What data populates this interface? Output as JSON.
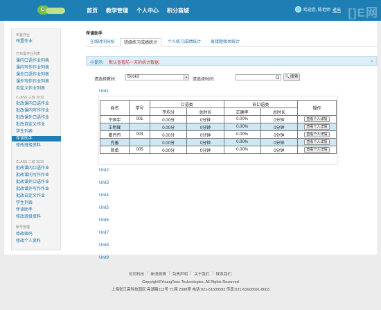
{
  "header": {
    "nav": [
      "首页",
      "教学管理",
      "个人中心",
      "积分商城"
    ],
    "user_text": "欢迎您, 陈老师",
    "logout": "退出",
    "watermark": "[]E网"
  },
  "sidebar": {
    "sections": [
      {
        "head": "布置作业",
        "items": [
          "布置作业"
        ]
      },
      {
        "head": "已布置作业列表",
        "items": [
          "课内口语作业列表",
          "课内写作作业列表",
          "课外口语作业列表",
          "课外写作作业列表",
          "自定义作业列表"
        ]
      },
      {
        "head": "CLASS 三班 2010",
        "items": [
          "批改课内口语作业",
          "批改课内写作作业",
          "批改课外口语作业",
          "批改自定义作业",
          "学生列表",
          "伴读助手",
          "修改班级资料"
        ]
      },
      {
        "head": "CLASS 二班 2010",
        "items": [
          "批改课内口语作业",
          "批改课内写作作业",
          "批改课外口语作业",
          "批改课外写作作业",
          "批改自定义作业",
          "学生列表",
          "伴读助手",
          "修改班级资料"
        ]
      },
      {
        "head": "帐号管理",
        "items": [
          "修改密码",
          "修改个人资料"
        ]
      }
    ],
    "active": "伴读助手"
  },
  "main": {
    "title": "伴读助手",
    "tabs": [
      "在线时间分析",
      "班级练习成绩统计",
      "个人练习成绩统计",
      "易错题相关统计"
    ],
    "active_tab": "班级练习成绩统计",
    "tip_prefix": "小提示:",
    "tip_text": "默认查看前一天的统计数据.",
    "filter": {
      "material_label": "请选择教材:",
      "material_value": "Book3",
      "time_label": "请选择时间:",
      "search_label": "搜索"
    },
    "units": [
      "Unit1",
      "Unit2",
      "Unit3",
      "Unit4",
      "Unit5",
      "Unit6",
      "Unit7",
      "Unit8",
      "Unit9"
    ],
    "table": {
      "headers": {
        "name": "姓名",
        "id": "学号",
        "speech": "口语类",
        "nonspeech": "非口语类",
        "op": "操作",
        "avg": "平均分",
        "total_time": "总时长",
        "accuracy": "正确率",
        "total_time2": "总时长"
      },
      "rows": [
        [
          "宁恒宇",
          "001",
          "0.00分",
          "0分钟",
          "0.00%",
          "0分钟",
          "查看个人详情"
        ],
        [
          "王明辉",
          "",
          "0.00分",
          "0分钟",
          "0.00%",
          "0分钟",
          "查看个人详情"
        ],
        [
          "瞿丹丹",
          "003",
          "0.00分",
          "0分钟",
          "0.00%",
          "0分钟",
          "查看个人详情"
        ],
        [
          "完善",
          "",
          "0.00分",
          "0分钟",
          "0.00%",
          "0分钟",
          "查看个人详情"
        ],
        [
          "简单",
          "005",
          "0.00分",
          "0分钟",
          "0.00%",
          "0分钟",
          "查看个人详情"
        ]
      ]
    }
  },
  "footer": {
    "links": [
      "优同科技",
      "新浪微博",
      "免责声明",
      "关于我们",
      "联系我们"
    ],
    "copyright": "Copyright©YoungTone Technologies, All Rights Reserved",
    "address": "上海张江高科技园区 亮湖路112号 Y1座 2088室 电话:021-61600593 传真:021-61600591-8003"
  }
}
